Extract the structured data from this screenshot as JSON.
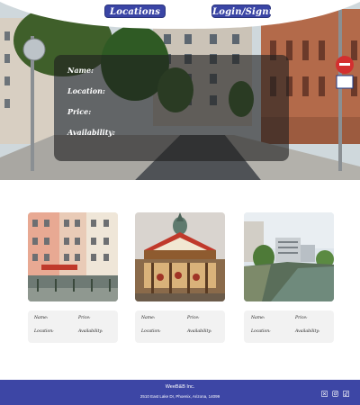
{
  "nav": {
    "locations_label": "Locations",
    "login_label": "Login/Signup"
  },
  "hero": {
    "labels": {
      "name": "Name:",
      "location": "Location:",
      "price": "Price:",
      "availability": "Availability:"
    }
  },
  "cards": [
    {
      "image": "colorful-apartment-building-photo",
      "name_label": "Name:",
      "price_label": "Price:",
      "location_label": "Location:",
      "availability_label": "Availability:"
    },
    {
      "image": "carousel-merry-go-round-photo",
      "name_label": "Name:",
      "price_label": "Price:",
      "location_label": "Location:",
      "availability_label": "Availability:"
    },
    {
      "image": "river-canal-city-photo",
      "name_label": "Name:",
      "price_label": "Price:",
      "location_label": "Location:",
      "availability_label": "Availability:"
    }
  ],
  "footer": {
    "company": "WeeB&B Inc.",
    "address": "2510 East Lake Dr, Phoenix, Arizona, 14099",
    "social_icons": [
      "x-twitter-icon",
      "instagram-icon",
      "tiktok-icon"
    ]
  },
  "colors": {
    "brand": "#3d46a5",
    "panel": "rgba(30,30,30,0.62)",
    "card_bg": "#f2f2f2"
  }
}
